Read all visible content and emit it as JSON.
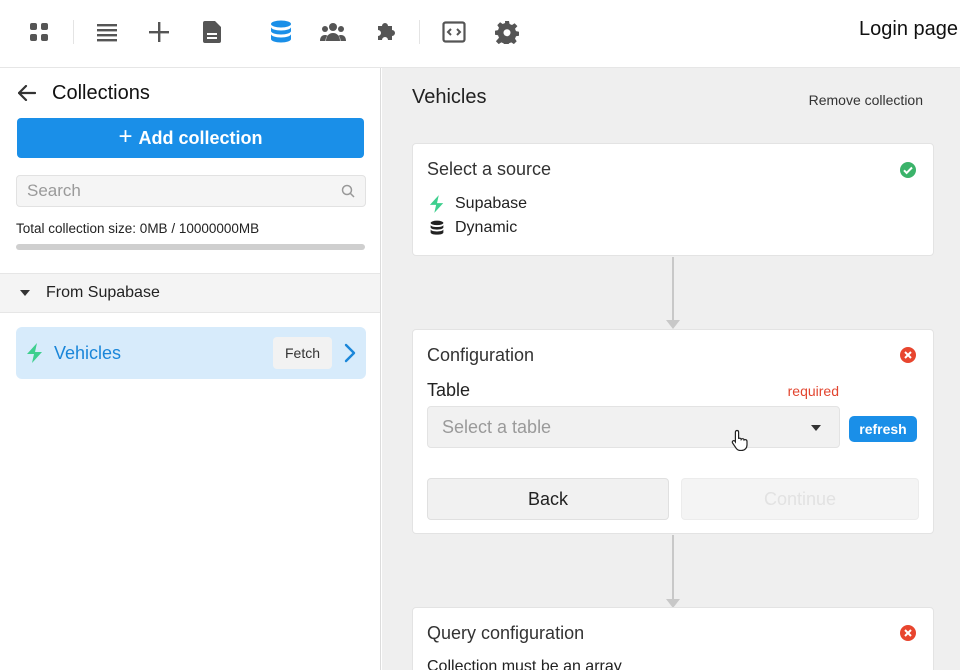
{
  "toolbar": {
    "icons": [
      "apps-icon",
      "list-icon",
      "plus-icon",
      "document-icon",
      "database-icon",
      "users-icon",
      "puzzle-icon",
      "code-icon",
      "gear-icon"
    ],
    "active_icon": "database-icon",
    "page_title": "Login page"
  },
  "sidebar": {
    "back_label": "Collections",
    "add_button_label": "Add collection",
    "search_placeholder": "Search",
    "size_text": "Total collection size: 0MB / 10000000MB",
    "size_used_fraction": 0.0,
    "group_label": "From Supabase",
    "items": [
      {
        "name": "Vehicles",
        "icon": "bolt-icon",
        "action_label": "Fetch",
        "selected": true
      }
    ]
  },
  "main": {
    "title": "Vehicles",
    "remove_label": "Remove collection",
    "source_card": {
      "title": "Select a source",
      "status": "ok",
      "sources": [
        {
          "icon": "bolt-icon",
          "label": "Supabase"
        },
        {
          "icon": "database-icon",
          "label": "Dynamic"
        }
      ]
    },
    "config_card": {
      "title": "Configuration",
      "status": "error",
      "table_label": "Table",
      "required_label": "required",
      "select_placeholder": "Select a table",
      "refresh_label": "refresh",
      "back_label": "Back",
      "continue_label": "Continue"
    },
    "query_card": {
      "title": "Query configuration",
      "status": "error",
      "message": "Collection must be an array"
    }
  },
  "colors": {
    "accent": "#1a8fe8",
    "success": "#3bb36a",
    "error": "#e8452e",
    "supabase": "#3ecf8e",
    "selected_bg": "#d7ebfb"
  }
}
